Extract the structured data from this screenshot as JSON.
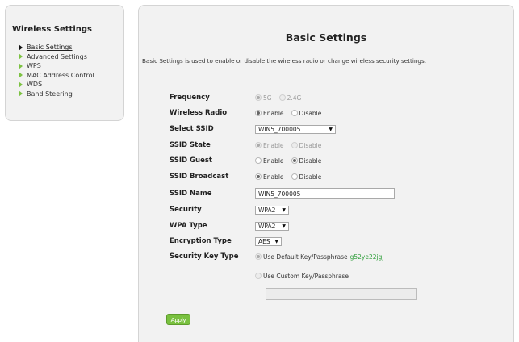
{
  "sidebar": {
    "title": "Wireless Settings",
    "items": [
      {
        "label": "Basic Settings",
        "active": true
      },
      {
        "label": "Advanced Settings"
      },
      {
        "label": "WPS"
      },
      {
        "label": "MAC Address Control"
      },
      {
        "label": "WDS"
      },
      {
        "label": "Band Steering"
      }
    ]
  },
  "main": {
    "title": "Basic Settings",
    "description": "Basic Settings is used to enable or disable the wireless radio or change wireless security settings.",
    "frequency": {
      "label": "Frequency",
      "options": [
        "5G",
        "2.4G"
      ],
      "selected": "5G"
    },
    "wireless_radio": {
      "label": "Wireless Radio",
      "options": [
        "Enable",
        "Disable"
      ],
      "selected": "Enable"
    },
    "select_ssid": {
      "label": "Select SSID",
      "value": "WIN5_700005"
    },
    "ssid_state": {
      "label": "SSID State",
      "options": [
        "Enable",
        "Disable"
      ],
      "selected": "Enable",
      "disabled": true
    },
    "ssid_guest": {
      "label": "SSID Guest",
      "options": [
        "Enable",
        "Disable"
      ],
      "selected": "Disable"
    },
    "ssid_broadcast": {
      "label": "SSID Broadcast",
      "options": [
        "Enable",
        "Disable"
      ],
      "selected": "Enable"
    },
    "ssid_name": {
      "label": "SSID Name",
      "value": "WIN5_700005"
    },
    "security": {
      "label": "Security",
      "value": "WPA2"
    },
    "wpa_type": {
      "label": "WPA Type",
      "value": "WPA2"
    },
    "encryption_type": {
      "label": "Encryption Type",
      "value": "AES"
    },
    "security_key_type": {
      "label": "Security Key Type",
      "default_option": "Use Default Key/Passphrase",
      "default_key": "g52ye22jgj",
      "custom_option": "Use Custom Key/Passphrase",
      "custom_value": ""
    },
    "apply_label": "Apply"
  },
  "colors": {
    "accent": "#79c13f",
    "passkey": "#2e9e3a",
    "panel_bg": "#f2f2f2"
  }
}
